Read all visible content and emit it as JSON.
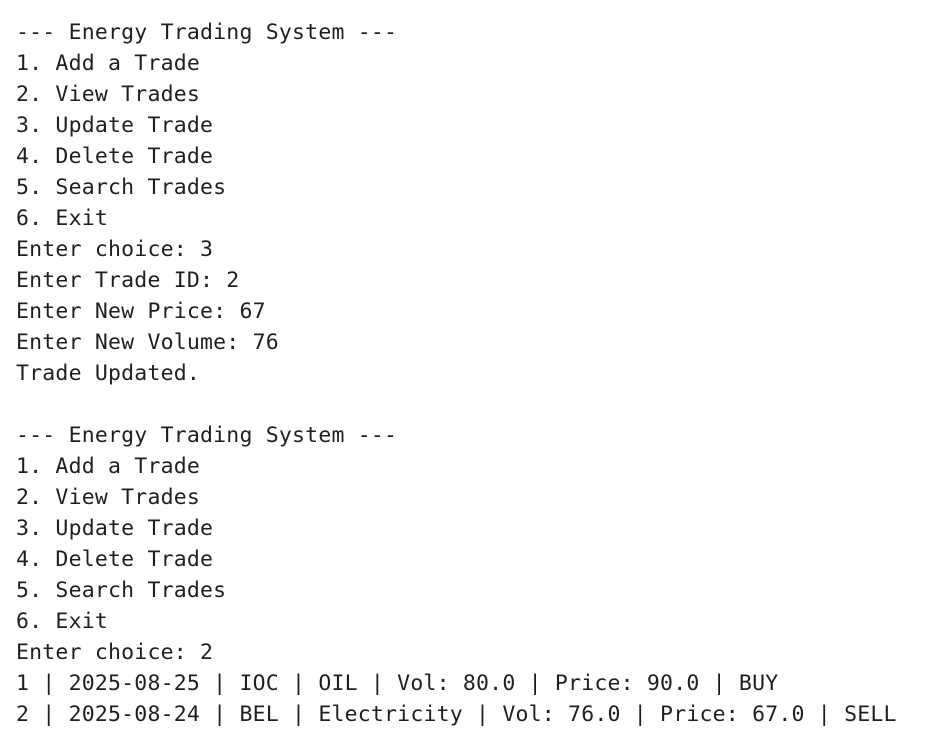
{
  "session1": {
    "header": "--- Energy Trading System ---",
    "menu": [
      "1. Add a Trade",
      "2. View Trades",
      "3. Update Trade",
      "4. Delete Trade",
      "5. Search Trades",
      "6. Exit"
    ],
    "prompts": [
      "Enter choice: 3",
      "Enter Trade ID: 2",
      "Enter New Price: 67",
      "Enter New Volume: 76"
    ],
    "result": "Trade Updated."
  },
  "session2": {
    "header": "--- Energy Trading System ---",
    "menu": [
      "1. Add a Trade",
      "2. View Trades",
      "3. Update Trade",
      "4. Delete Trade",
      "5. Search Trades",
      "6. Exit"
    ],
    "prompt": "Enter choice: 2",
    "trades": [
      "1 | 2025-08-25 | IOC | OIL | Vol: 80.0 | Price: 90.0 | BUY",
      "2 | 2025-08-24 | BEL | Electricity | Vol: 76.0 | Price: 67.0 | SELL"
    ]
  }
}
